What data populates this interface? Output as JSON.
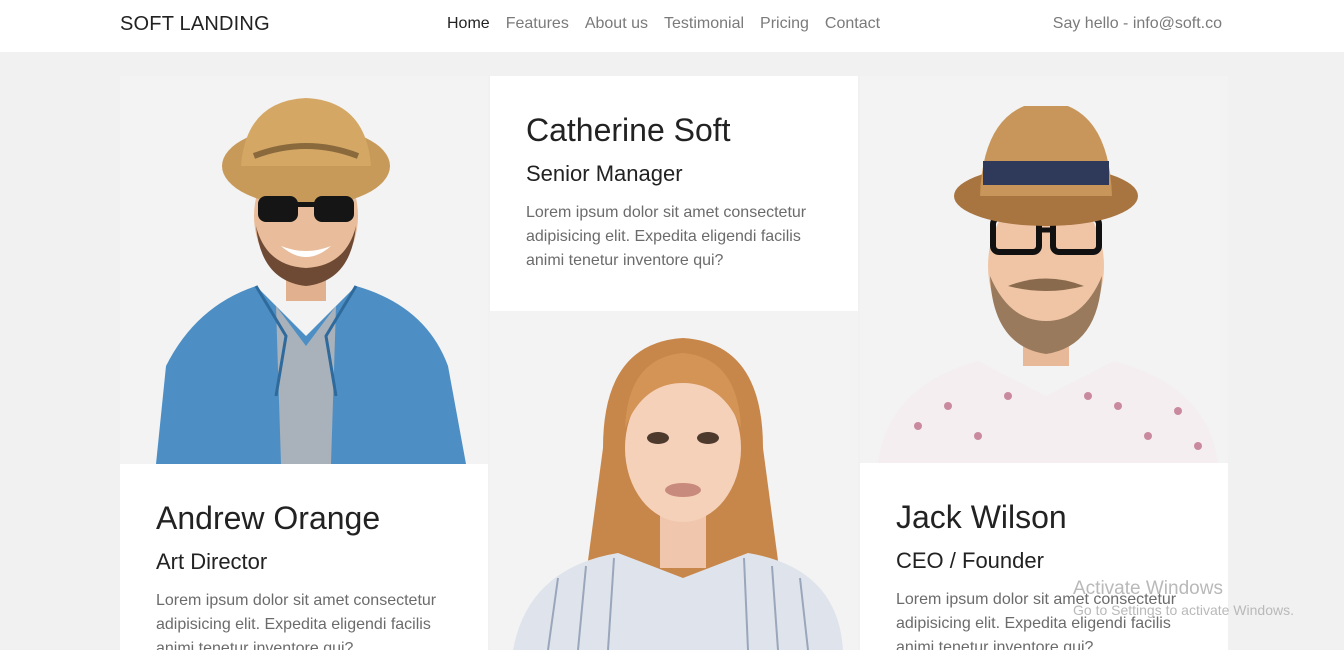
{
  "header": {
    "brand": "SOFT LANDING",
    "nav": [
      "Home",
      "Features",
      "About us",
      "Testimonial",
      "Pricing",
      "Contact"
    ],
    "contact": "Say hello - info@soft.co"
  },
  "team": [
    {
      "name": "Andrew Orange",
      "role": "Art Director",
      "desc": "Lorem ipsum dolor sit amet consectetur adipisicing elit. Expedita eligendi facilis animi tenetur inventore qui?"
    },
    {
      "name": "Catherine Soft",
      "role": "Senior Manager",
      "desc": "Lorem ipsum dolor sit amet consectetur adipisicing elit. Expedita eligendi facilis animi tenetur inventore qui?"
    },
    {
      "name": "Jack Wilson",
      "role": "CEO / Founder",
      "desc": "Lorem ipsum dolor sit amet consectetur adipisicing elit. Expedita eligendi facilis animi tenetur inventore qui?"
    }
  ],
  "watermark": {
    "line1": "Activate Windows",
    "line2": "Go to Settings to activate Windows."
  }
}
